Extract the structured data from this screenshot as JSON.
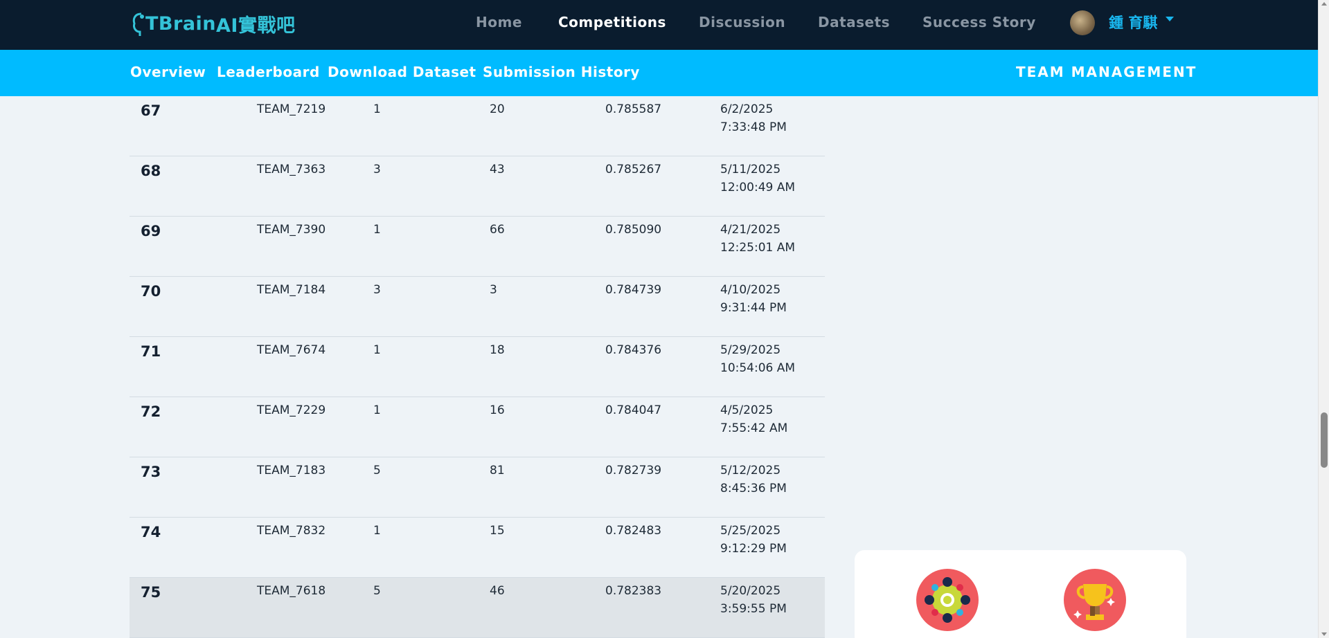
{
  "brand": {
    "logo_text": "TBrain",
    "logo_sub": "AI實戰吧"
  },
  "nav": {
    "items": [
      {
        "label": "Home",
        "active": false
      },
      {
        "label": "Competitions",
        "active": true
      },
      {
        "label": "Discussion",
        "active": false
      },
      {
        "label": "Datasets",
        "active": false
      },
      {
        "label": "Success Story",
        "active": false
      }
    ]
  },
  "user": {
    "name": "鍾 育騏"
  },
  "subnav": {
    "items": [
      {
        "label": "Overview"
      },
      {
        "label": "Leaderboard"
      },
      {
        "label": "Download Dataset"
      },
      {
        "label": "Submission History"
      }
    ],
    "team_management": "TEAM MANAGEMENT"
  },
  "leaderboard": {
    "rows": [
      {
        "rank": "67",
        "team": "TEAM_7219",
        "members": "1",
        "entries": "20",
        "score": "0.785587",
        "date": "6/2/2025",
        "time": "7:33:48 PM"
      },
      {
        "rank": "68",
        "team": "TEAM_7363",
        "members": "3",
        "entries": "43",
        "score": "0.785267",
        "date": "5/11/2025",
        "time": "12:00:49 AM"
      },
      {
        "rank": "69",
        "team": "TEAM_7390",
        "members": "1",
        "entries": "66",
        "score": "0.785090",
        "date": "4/21/2025",
        "time": "12:25:01 AM"
      },
      {
        "rank": "70",
        "team": "TEAM_7184",
        "members": "3",
        "entries": "3",
        "score": "0.784739",
        "date": "4/10/2025",
        "time": "9:31:44 PM"
      },
      {
        "rank": "71",
        "team": "TEAM_7674",
        "members": "1",
        "entries": "18",
        "score": "0.784376",
        "date": "5/29/2025",
        "time": "10:54:06 AM"
      },
      {
        "rank": "72",
        "team": "TEAM_7229",
        "members": "1",
        "entries": "16",
        "score": "0.784047",
        "date": "4/5/2025",
        "time": "7:55:42 AM"
      },
      {
        "rank": "73",
        "team": "TEAM_7183",
        "members": "5",
        "entries": "81",
        "score": "0.782739",
        "date": "5/12/2025",
        "time": "8:45:36 PM"
      },
      {
        "rank": "74",
        "team": "TEAM_7832",
        "members": "1",
        "entries": "15",
        "score": "0.782483",
        "date": "5/25/2025",
        "time": "9:12:29 PM"
      },
      {
        "rank": "75",
        "team": "TEAM_7618",
        "members": "5",
        "entries": "46",
        "score": "0.782383",
        "date": "5/20/2025",
        "time": "3:59:55 PM"
      }
    ]
  },
  "colors": {
    "topbar": "#0a1c2e",
    "subbar": "#00bbff",
    "accent": "#19b6ee",
    "badge": "#f05a5e"
  },
  "icons": [
    "brain-logo-icon",
    "user-avatar",
    "chevron-down-icon",
    "team-badge-icon",
    "trophy-badge-icon"
  ]
}
